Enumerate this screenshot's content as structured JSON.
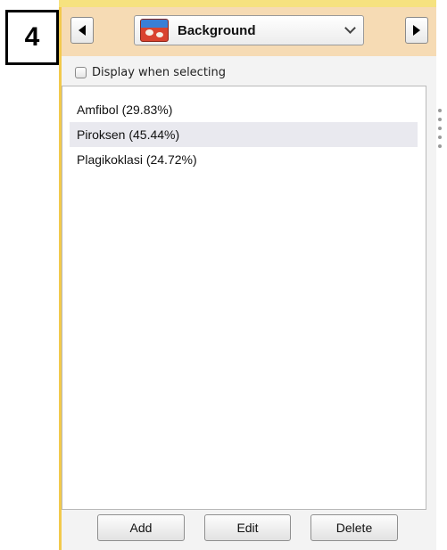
{
  "step_badge": "4",
  "header": {
    "layer_select": {
      "selected": "Background",
      "icon": "map-layer-icon"
    },
    "prev_icon": "triangle-left-icon",
    "next_icon": "triangle-right-icon"
  },
  "display_when_selecting": {
    "label": "Display when selecting",
    "checked": false
  },
  "list": {
    "items": [
      {
        "label": "Amfibol (29.83%)",
        "selected": false
      },
      {
        "label": "Piroksen (45.44%)",
        "selected": true
      },
      {
        "label": "Plagikoklasi (24.72%)",
        "selected": false
      }
    ]
  },
  "buttons": {
    "add": "Add",
    "edit": "Edit",
    "delete": "Delete"
  },
  "colors": {
    "header_bg": "#f6dbb4",
    "panel_border": "#f2c94c",
    "selected_row": "#e9e9ef"
  }
}
